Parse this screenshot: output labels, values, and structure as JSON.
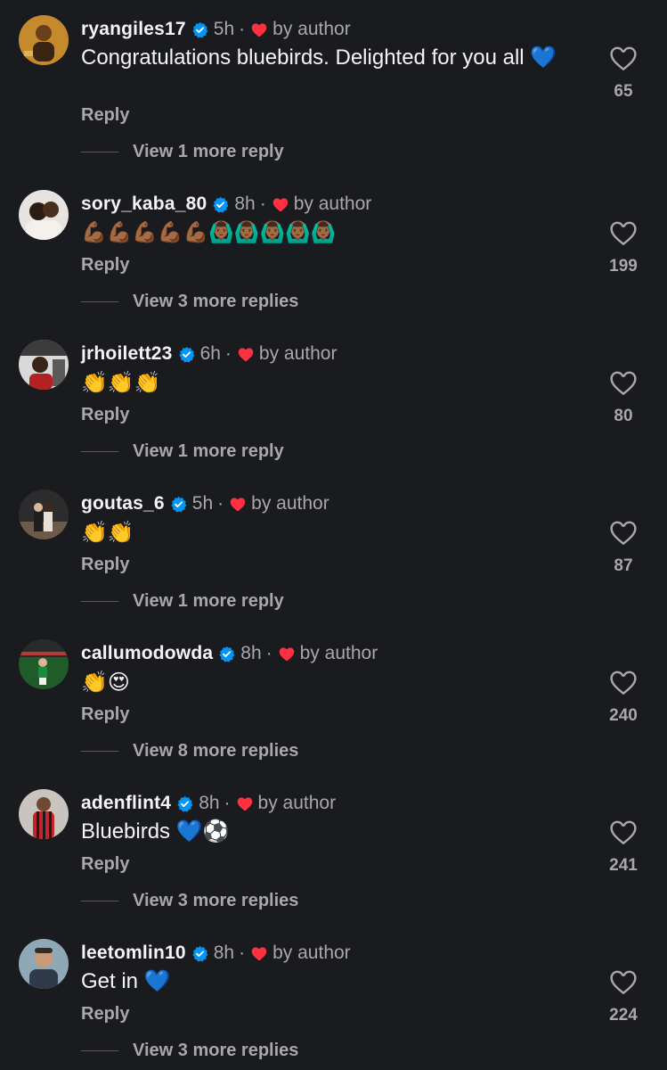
{
  "colors": {
    "background": "#1a1b1f",
    "verified": "#0095f6",
    "author_heart": "#ff3040",
    "secondary_text": "#a8a8a8"
  },
  "icons": {
    "verified": "verified-badge-icon",
    "author_like": "heart-filled-icon",
    "like": "heart-outline-icon"
  },
  "labels": {
    "by_author": "by author",
    "reply": "Reply",
    "separator": "·"
  },
  "comments": [
    {
      "username": "ryangiles17",
      "time": "5h",
      "text": "Congratulations bluebirds. Delighted for you all 💙",
      "likes": "65",
      "view_replies": "View 1 more reply"
    },
    {
      "username": "sory_kaba_80",
      "time": "8h",
      "text": "💪🏾💪🏾💪🏾💪🏾💪🏾🙆🏾‍♂️🙆🏾‍♂️🙆🏾‍♂️🙆🏾‍♂️🙆🏾‍♂️",
      "likes": "199",
      "view_replies": "View 3 more replies"
    },
    {
      "username": "jrhoilett23",
      "time": "6h",
      "text": "👏👏👏",
      "likes": "80",
      "view_replies": "View 1 more reply"
    },
    {
      "username": "goutas_6",
      "time": "5h",
      "text": "👏👏",
      "likes": "87",
      "view_replies": "View 1 more reply"
    },
    {
      "username": "callumodowda",
      "time": "8h",
      "text": "👏😍",
      "likes": "240",
      "view_replies": "View 8 more replies"
    },
    {
      "username": "adenflint4",
      "time": "8h",
      "text": "Bluebirds 💙⚽️",
      "likes": "241",
      "view_replies": "View 3 more replies"
    },
    {
      "username": "leetomlin10",
      "time": "8h",
      "text": "Get in 💙",
      "likes": "224",
      "view_replies": "View 3 more replies"
    }
  ]
}
